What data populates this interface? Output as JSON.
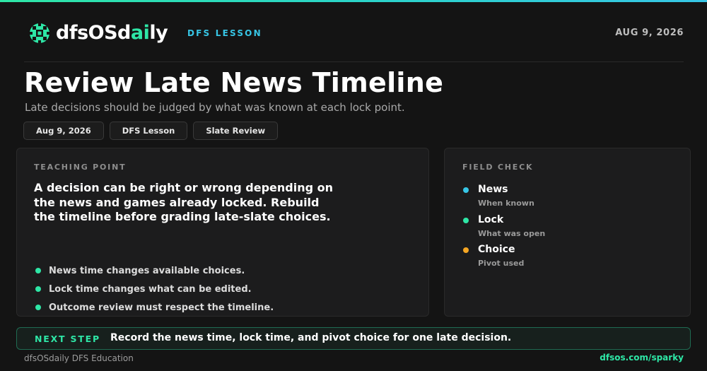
{
  "header": {
    "brand_prefix": "dfsOSd",
    "brand_accent": "ai",
    "brand_suffix": "ly",
    "kicker": "DFS LESSON",
    "date": "AUG 9, 2026"
  },
  "title": "Review Late News Timeline",
  "subtitle": "Late decisions should be judged by what was known at each lock point.",
  "chips": [
    "Aug 9, 2026",
    "DFS Lesson",
    "Slate Review"
  ],
  "teaching": {
    "label": "TEACHING POINT",
    "lead": "A decision can be right or wrong depending on the news and games already locked. Rebuild the timeline before grading late-slate choices.",
    "bullets": [
      "News time changes available choices.",
      "Lock time changes what can be edited.",
      "Outcome review must respect the timeline."
    ]
  },
  "field_check": {
    "label": "FIELD CHECK",
    "items": [
      {
        "name": "News",
        "desc": "When known",
        "color": "#37c6e6"
      },
      {
        "name": "Lock",
        "desc": "What was open",
        "color": "#2ee6a6"
      },
      {
        "name": "Choice",
        "desc": "Pivot used",
        "color": "#f5a623"
      }
    ]
  },
  "next_step": {
    "label": "NEXT STEP",
    "text": "Record the news time, lock time, and pivot choice for one late decision."
  },
  "footer": {
    "left": "dfsOSdaily DFS Education",
    "right": "dfsos.com/sparky"
  },
  "colors": {
    "accent_green": "#2ee6a6",
    "accent_cyan": "#37c6e6",
    "accent_orange": "#f5a623",
    "background": "#141414"
  }
}
